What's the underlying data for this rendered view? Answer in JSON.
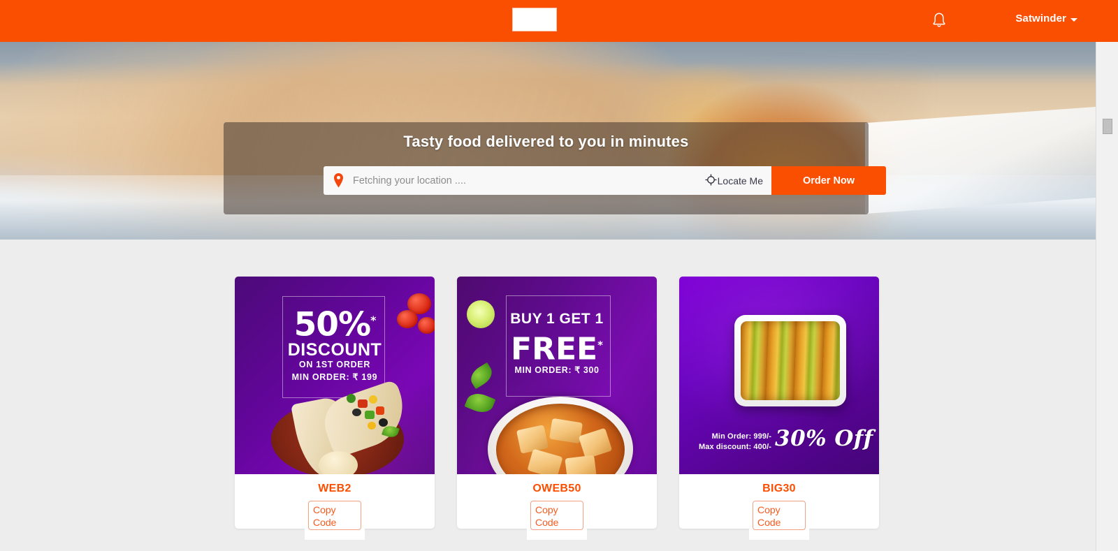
{
  "topbar": {
    "logo_alt": "",
    "bell_icon": "bell-icon",
    "user_name": "Satwinder"
  },
  "hero": {
    "title": "Tasty food delivered to you in minutes",
    "location_placeholder": "Fetching your location ....",
    "location_value": "",
    "locate_me_label": "Locate Me",
    "order_now_label": "Order Now",
    "pin_icon": "location-pin-icon",
    "locate_icon": "crosshair-icon"
  },
  "promos": [
    {
      "banner": {
        "percent": "50%",
        "asterisk": "*",
        "headline": "DISCOUNT",
        "sub1": "ON 1ST ORDER",
        "sub2": "MIN ORDER: ₹ 199"
      },
      "code": "WEB2",
      "copy_label": "Copy Code"
    },
    {
      "banner": {
        "line1": "BUY 1 GET 1",
        "line2": "FREE",
        "asterisk": "*",
        "sub1": "MIN ORDER: ₹ 300"
      },
      "code": "OWEB50",
      "copy_label": "Copy Code"
    },
    {
      "banner": {
        "min_order": "Min Order: 999/-",
        "max_discount": "Max discount: 400/-",
        "offer": "30% Off"
      },
      "code": "BIG30",
      "copy_label": "Copy Code"
    }
  ],
  "colors": {
    "brand_orange": "#fa4e00",
    "page_background": "#ededed",
    "promo_purple": "#6a05bf",
    "code_text": "#fa4e00",
    "copy_border": "#f3a183"
  }
}
